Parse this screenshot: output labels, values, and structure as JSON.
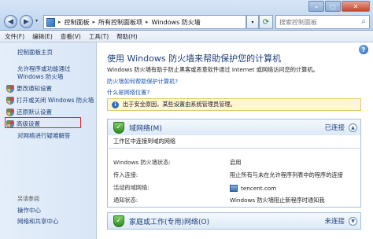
{
  "window": {
    "nav": {
      "back": "◀",
      "forward": "▶",
      "recent": "▾"
    },
    "breadcrumb": [
      "控制面板",
      "所有控制面板项",
      "Windows 防火墙"
    ],
    "breadcrumb_sep": "▸",
    "search_placeholder": "搜索控制面板",
    "controls": {
      "minimize": "–",
      "maximize": "□",
      "close": "✕"
    }
  },
  "menu": [
    "文件(F)",
    "编辑(E)",
    "查看(V)",
    "工具(T)",
    "帮助(H)"
  ],
  "sidebar": {
    "home": "控制面板主页",
    "items": [
      {
        "label": "允许程序或功能通过 Windows 防火墙",
        "icon": false
      },
      {
        "label": "更改通知设置",
        "icon": true
      },
      {
        "label": "打开或关闭 Windows 防火墙",
        "icon": true
      },
      {
        "label": "还原默认设置",
        "icon": true
      },
      {
        "label": "高级设置",
        "icon": true
      },
      {
        "label": "对网络进行疑难解答",
        "icon": false
      }
    ],
    "see_also": "另请参阅",
    "see_also_items": [
      "操作中心",
      "网络和共享中心"
    ]
  },
  "main": {
    "title": "使用 Windows 防火墙来帮助保护您的计算机",
    "description": "Windows 防火墙有助于防止黑客或恶意软件通过 Internet 或网络访问您的计算机。",
    "link_help": "防火墙如何帮助保护计算机?",
    "link_location": "什么是网络位置?",
    "notice": "出于安全原因，某些设置由系统管理员管理。",
    "panels": [
      {
        "name": "域网络(M)",
        "status": "已连接",
        "subtitle": "工作区中连接到域的网络",
        "rows": [
          {
            "key": "Windows 防火墙状态:",
            "value": "启用"
          },
          {
            "key": "传入连接:",
            "value": "阻止所有与未在允许程序列表中的程序的连接"
          },
          {
            "key": "活动的域网络:",
            "value": "tencent.com"
          },
          {
            "key": "通知状态:",
            "value": "Windows 防火墙阻止新程序时通知我"
          }
        ]
      },
      {
        "name": "家庭或工作(专用)网络(O)",
        "status": "未连接"
      }
    ]
  },
  "colors": {
    "link": "#1b55b5",
    "title": "#1e3f7a",
    "highlight_box": "#d9262a",
    "notice_bg": "#fff7d1"
  }
}
